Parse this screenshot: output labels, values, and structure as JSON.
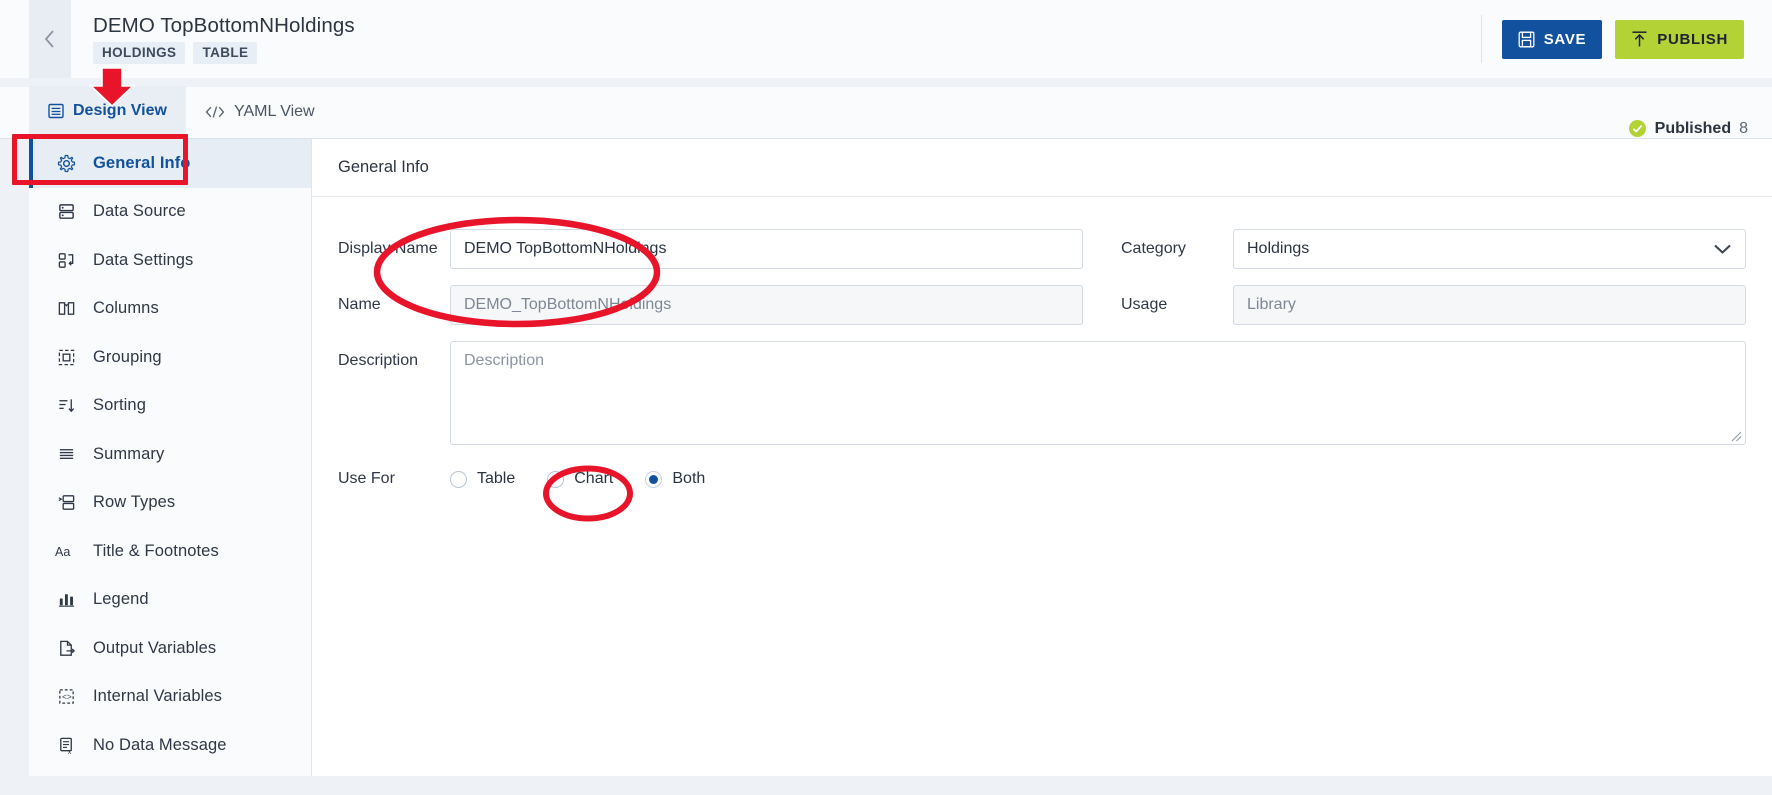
{
  "header": {
    "back_icon": "chevron-left-icon",
    "title": "DEMO TopBottomNHoldings",
    "badges": [
      "HOLDINGS",
      "TABLE"
    ],
    "save_label": "SAVE",
    "save_icon": "floppy-disk-save-icon",
    "save_color": "#11519e",
    "publish_label": "PUBLISH",
    "publish_icon": "upload-arrow-icon",
    "publish_color": "#b3d235"
  },
  "tabs": {
    "items": [
      {
        "label": "Design View",
        "icon": "design-view-icon",
        "active": true
      },
      {
        "label": "YAML View",
        "icon": "code-brackets-icon",
        "active": false
      }
    ],
    "status": {
      "icon": "check-circle-icon",
      "label": "Published",
      "count": "8",
      "icon_color": "#b3d235"
    }
  },
  "sidebar": {
    "items": [
      {
        "label": "General Info",
        "icon": "gear-icon",
        "active": true
      },
      {
        "label": "Data Source",
        "icon": "database-icon",
        "active": false
      },
      {
        "label": "Data Settings",
        "icon": "data-settings-icon",
        "active": false
      },
      {
        "label": "Columns",
        "icon": "columns-icon",
        "active": false
      },
      {
        "label": "Grouping",
        "icon": "grouping-icon",
        "active": false
      },
      {
        "label": "Sorting",
        "icon": "sorting-icon",
        "active": false
      },
      {
        "label": "Summary",
        "icon": "summary-lines-icon",
        "active": false
      },
      {
        "label": "Row Types",
        "icon": "row-types-icon",
        "active": false
      },
      {
        "label": "Title & Footnotes",
        "icon": "text-aa-icon",
        "active": false
      },
      {
        "label": "Legend",
        "icon": "bar-chart-icon",
        "active": false
      },
      {
        "label": "Output Variables",
        "icon": "output-file-icon",
        "active": false
      },
      {
        "label": "Internal Variables",
        "icon": "internal-variable-icon",
        "active": false
      },
      {
        "label": "No Data Message",
        "icon": "no-data-icon",
        "active": false
      }
    ]
  },
  "main": {
    "section_title": "General Info",
    "fields": {
      "display_name_label": "Display Name",
      "display_name_value": "DEMO TopBottomNHoldings",
      "name_label": "Name",
      "name_value": "DEMO_TopBottomNHoldings",
      "category_label": "Category",
      "category_value": "Holdings",
      "category_chevron": "chevron-down-icon",
      "usage_label": "Usage",
      "usage_value": "Library",
      "description_label": "Description",
      "description_placeholder": "Description"
    },
    "use_for": {
      "label": "Use For",
      "options": [
        {
          "label": "Table",
          "selected": false
        },
        {
          "label": "Chart",
          "selected": false
        },
        {
          "label": "Both",
          "selected": true
        }
      ]
    }
  },
  "annotations": {
    "color": "#e8142a",
    "arrow_target": "Design View",
    "rect_target": "General Info",
    "ellipse_targets": [
      "Display Name / Name fields",
      "Both radio option"
    ]
  }
}
